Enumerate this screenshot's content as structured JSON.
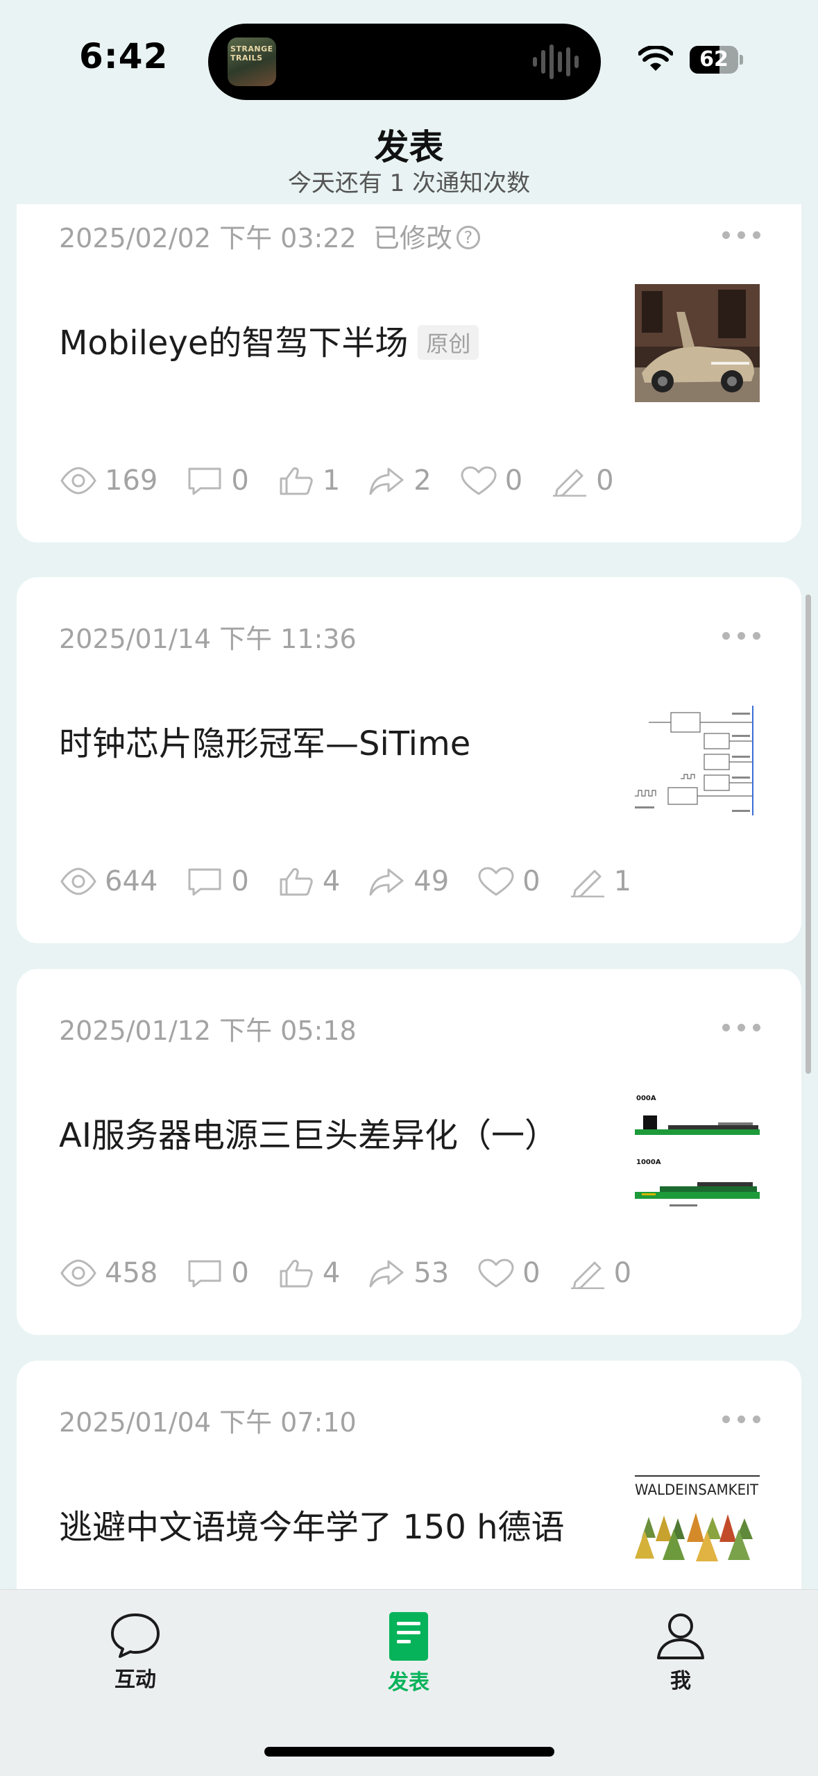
{
  "status_bar": {
    "time": "6:42",
    "battery_percent": 62,
    "now_playing_art_text": "STRANGE TRAILS"
  },
  "header": {
    "title": "发表",
    "subtitle": "今天还有 1 次通知次数"
  },
  "posts": [
    {
      "date": "2025/02/02 下午 03:22",
      "modified_label": "已修改",
      "title": "Mobileye的智驾下半场",
      "badge": "原创",
      "stats": {
        "views": "169",
        "comments": "0",
        "likes": "1",
        "shares": "2",
        "favorites": "0",
        "notes": "0"
      }
    },
    {
      "date": "2025/01/14 下午 11:36",
      "title": "时钟芯片隐形冠军—SiTime",
      "stats": {
        "views": "644",
        "comments": "0",
        "likes": "4",
        "shares": "49",
        "favorites": "0",
        "notes": "1"
      }
    },
    {
      "date": "2025/01/12 下午 05:18",
      "title": "AI服务器电源三巨头差异化（一）",
      "thumb_labels": [
        "000A",
        "1000A"
      ],
      "stats": {
        "views": "458",
        "comments": "0",
        "likes": "4",
        "shares": "53",
        "favorites": "0",
        "notes": "0"
      }
    },
    {
      "date": "2025/01/04 下午 07:10",
      "title": "逃避中文语境今年学了 150 h德语",
      "thumb_text": "WALDEINSAMKEIT"
    }
  ],
  "tabbar": {
    "items": [
      {
        "label": "互动",
        "icon": "chat-bubble-icon"
      },
      {
        "label": "发表",
        "icon": "document-icon",
        "active": true
      },
      {
        "label": "我",
        "icon": "person-icon"
      }
    ],
    "active_color": "#07b35a"
  }
}
